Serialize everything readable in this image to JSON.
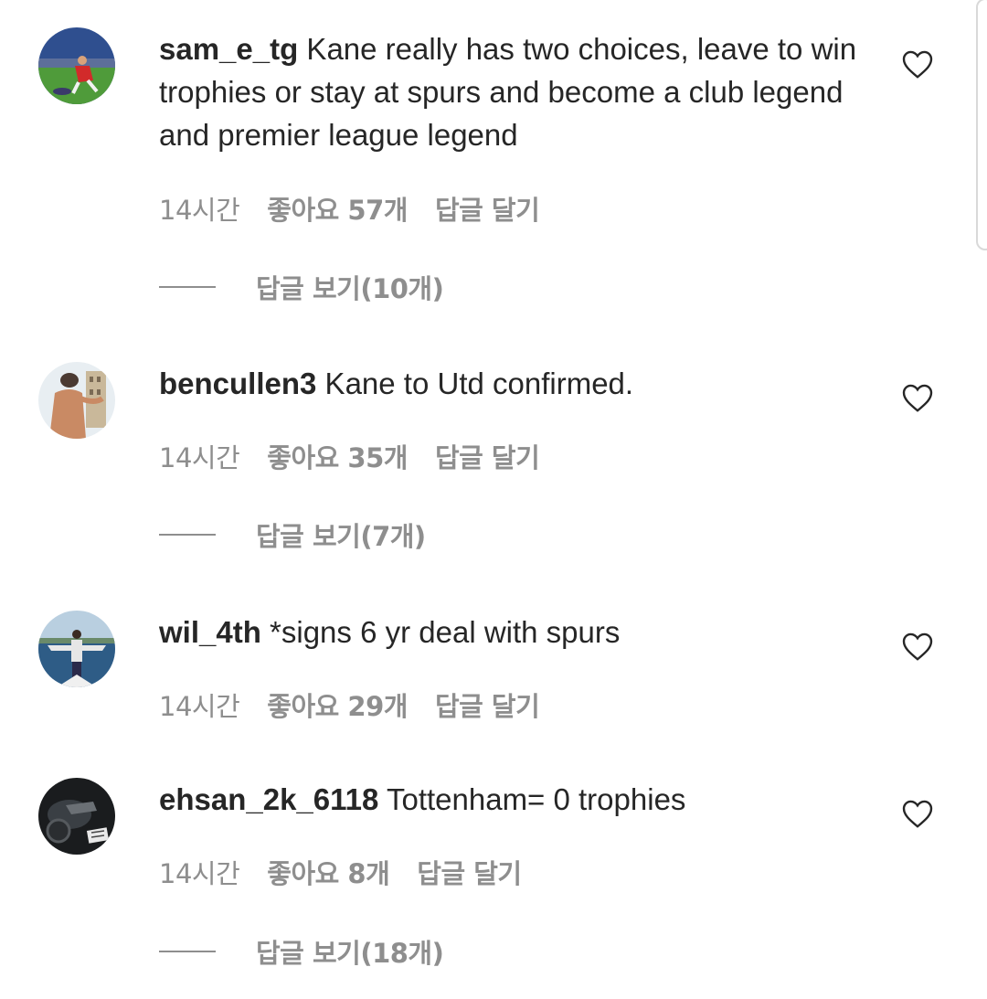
{
  "comments": [
    {
      "username": "sam_e_tg",
      "text": " Kane really has two choices, leave to win trophies or stay at spurs and become a club legend and premier league legend",
      "time": "14시간",
      "likes": "좋아요 57개",
      "reply": "답글 달기",
      "view_replies": "답글 보기(10개)"
    },
    {
      "username": "bencullen3",
      "text": " Kane to Utd confirmed.",
      "time": "14시간",
      "likes": "좋아요 35개",
      "reply": "답글 달기",
      "view_replies": "답글 보기(7개)"
    },
    {
      "username": "wil_4th",
      "text": " *signs 6 yr deal with spurs",
      "time": "14시간",
      "likes": "좋아요 29개",
      "reply": "답글 달기"
    },
    {
      "username": "ehsan_2k_6118",
      "text": " Tottenham= 0 trophies",
      "time": "14시간",
      "likes": "좋아요 8개",
      "reply": "답글 달기",
      "view_replies": "답글 보기(18개)"
    }
  ],
  "icons": {
    "like": "heart-outline-icon"
  },
  "colors": {
    "text": "#262626",
    "secondary": "#8e8e8e"
  }
}
